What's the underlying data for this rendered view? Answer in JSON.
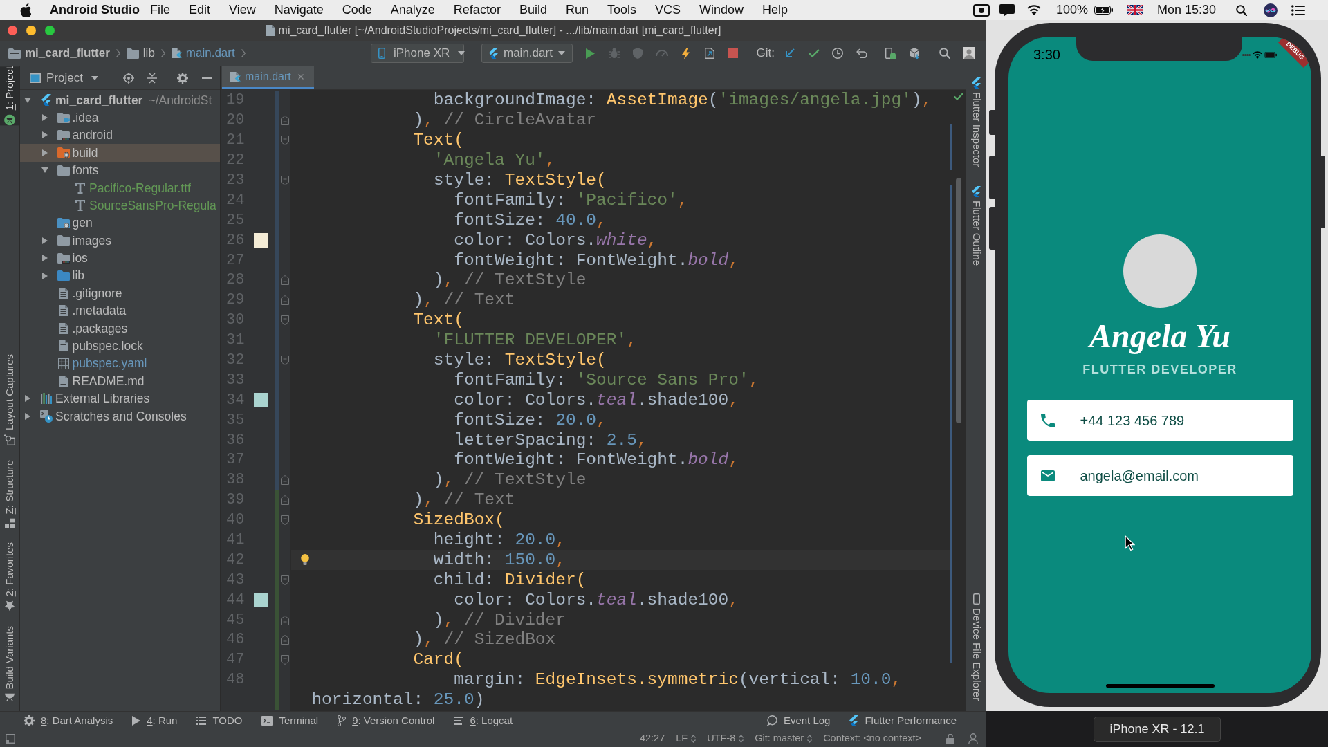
{
  "menu_bar": {
    "app": "Android Studio",
    "menus": [
      "File",
      "Edit",
      "View",
      "Navigate",
      "Code",
      "Analyze",
      "Refactor",
      "Build",
      "Run",
      "Tools",
      "VCS",
      "Window",
      "Help"
    ],
    "battery": "100%",
    "clock": "Mon 15:30"
  },
  "window": {
    "title": "mi_card_flutter [~/AndroidStudioProjects/mi_card_flutter] - .../lib/main.dart [mi_card_flutter]"
  },
  "breadcrumbs": [
    {
      "label": "mi_card_flutter",
      "kind": "project-folder"
    },
    {
      "label": "lib",
      "kind": "folder"
    },
    {
      "label": "main.dart",
      "kind": "dart",
      "color": "#6897bb"
    }
  ],
  "toolbar": {
    "device": "iPhone XR",
    "run_config": "main.dart",
    "vcs_label": "Git:"
  },
  "left_tool_windows": {
    "top": [
      {
        "label": "1: Project",
        "kind": "project",
        "mnemonic": true,
        "selected": true
      }
    ],
    "bottom": [
      {
        "label": "Layout Captures",
        "kind": "layout-captures",
        "mnemonic": false,
        "selected": false
      },
      {
        "label": "Z: Structure",
        "kind": "structure",
        "mnemonic": true,
        "selected": false
      },
      {
        "label": "2: Favorites",
        "kind": "favorites",
        "mnemonic": true,
        "selected": false
      },
      {
        "label": "Build Variants",
        "kind": "build-variants",
        "mnemonic": false,
        "selected": false
      }
    ]
  },
  "project": {
    "title": "Project",
    "tree": [
      {
        "label": "mi_card_flutter",
        "path": "~/AndroidSt",
        "kind": "flutter",
        "expanded": true,
        "selected": false,
        "children": [
          {
            "label": ".idea",
            "kind": "idea-folder",
            "expanded": false,
            "selected": false
          },
          {
            "label": "android",
            "kind": "module-folder",
            "expanded": false,
            "selected": false
          },
          {
            "label": "build",
            "kind": "excluded-folder",
            "expanded": false,
            "selected": true
          },
          {
            "label": "fonts",
            "kind": "folder",
            "expanded": true,
            "selected": false,
            "children": [
              {
                "label": "Pacifico-Regular.ttf",
                "kind": "font",
                "color": "#629755",
                "selected": false
              },
              {
                "label": "SourceSansPro-Regula",
                "kind": "font",
                "color": "#629755",
                "selected": false
              }
            ]
          },
          {
            "label": "gen",
            "kind": "generated-folder",
            "selected": false
          },
          {
            "label": "images",
            "kind": "folder",
            "expanded": false,
            "selected": false
          },
          {
            "label": "ios",
            "kind": "module-folder",
            "expanded": false,
            "selected": false
          },
          {
            "label": "lib",
            "kind": "source-folder",
            "expanded": false,
            "selected": false
          },
          {
            "label": ".gitignore",
            "kind": "file",
            "selected": false
          },
          {
            "label": ".metadata",
            "kind": "file",
            "selected": false
          },
          {
            "label": ".packages",
            "kind": "file",
            "selected": false
          },
          {
            "label": "pubspec.lock",
            "kind": "file",
            "selected": false
          },
          {
            "label": "pubspec.yaml",
            "kind": "table-file",
            "color": "#6897bb",
            "selected": false
          },
          {
            "label": "README.md",
            "kind": "file",
            "selected": false
          }
        ]
      },
      {
        "label": "External Libraries",
        "kind": "libraries",
        "expanded": false,
        "selected": false
      },
      {
        "label": "Scratches and Consoles",
        "kind": "scratches",
        "expanded": false,
        "selected": false
      }
    ]
  },
  "editor": {
    "tabs": [
      {
        "label": "main.dart",
        "color": "#6897bb",
        "selected": true
      }
    ],
    "lines": [
      {
        "number": "19",
        "change": {
          "kind": "modified"
        },
        "current": false,
        "tokens": [
          {
            "kind": "plain",
            "text": "              backgroundImage: "
          },
          {
            "kind": "call",
            "text": "AssetImage"
          },
          {
            "kind": "plain",
            "text": "("
          },
          {
            "kind": "string",
            "text": "'images/angela.jpg'"
          },
          {
            "kind": "plain",
            "text": ")"
          },
          {
            "kind": "comma",
            "text": ","
          }
        ]
      },
      {
        "number": "20",
        "change": {
          "kind": "modified"
        },
        "current": false,
        "fold": {
          "kind": "end"
        },
        "tokens": [
          {
            "kind": "plain",
            "text": "            )"
          },
          {
            "kind": "comma",
            "text": ","
          },
          {
            "kind": "comment",
            "text": " // CircleAvatar"
          }
        ]
      },
      {
        "number": "21",
        "change": {
          "kind": "modified"
        },
        "current": false,
        "fold": {
          "kind": "start"
        },
        "tokens": [
          {
            "kind": "call",
            "text": "            Text("
          }
        ]
      },
      {
        "number": "22",
        "change": {
          "kind": "modified"
        },
        "current": false,
        "tokens": [
          {
            "kind": "string",
            "text": "              'Angela Yu'"
          },
          {
            "kind": "comma",
            "text": ","
          }
        ]
      },
      {
        "number": "23",
        "change": {
          "kind": "modified"
        },
        "current": false,
        "fold": {
          "kind": "start"
        },
        "tokens": [
          {
            "kind": "plain",
            "text": "              style: "
          },
          {
            "kind": "call",
            "text": "TextStyle("
          }
        ]
      },
      {
        "number": "24",
        "change": {
          "kind": "modified"
        },
        "current": false,
        "tokens": [
          {
            "kind": "plain",
            "text": "                fontFamily: "
          },
          {
            "kind": "string",
            "text": "'Pacifico'"
          },
          {
            "kind": "comma",
            "text": ","
          }
        ]
      },
      {
        "number": "25",
        "change": {
          "kind": "modified"
        },
        "current": false,
        "tokens": [
          {
            "kind": "plain",
            "text": "                fontSize: "
          },
          {
            "kind": "number",
            "text": "40.0"
          },
          {
            "kind": "comma",
            "text": ","
          }
        ]
      },
      {
        "number": "26",
        "change": {
          "kind": "modified"
        },
        "current": false,
        "color": "#f4ecd6",
        "tokens": [
          {
            "kind": "plain",
            "text": "                color: Colors."
          },
          {
            "kind": "field",
            "text": "white"
          },
          {
            "kind": "comma",
            "text": ","
          }
        ]
      },
      {
        "number": "27",
        "change": {
          "kind": "modified"
        },
        "current": false,
        "tokens": [
          {
            "kind": "plain",
            "text": "                fontWeight: FontWeight."
          },
          {
            "kind": "field",
            "text": "bold"
          },
          {
            "kind": "comma",
            "text": ","
          }
        ]
      },
      {
        "number": "28",
        "change": {
          "kind": "modified"
        },
        "current": false,
        "fold": {
          "kind": "end"
        },
        "tokens": [
          {
            "kind": "plain",
            "text": "              )"
          },
          {
            "kind": "comma",
            "text": ","
          },
          {
            "kind": "comment",
            "text": " // TextStyle"
          }
        ]
      },
      {
        "number": "29",
        "change": {
          "kind": "modified"
        },
        "current": false,
        "fold": {
          "kind": "end"
        },
        "tokens": [
          {
            "kind": "plain",
            "text": "            )"
          },
          {
            "kind": "comma",
            "text": ","
          },
          {
            "kind": "comment",
            "text": " // Text"
          }
        ]
      },
      {
        "number": "30",
        "change": {
          "kind": "modified"
        },
        "current": false,
        "fold": {
          "kind": "start"
        },
        "tokens": [
          {
            "kind": "call",
            "text": "            Text("
          }
        ]
      },
      {
        "number": "31",
        "change": {
          "kind": "modified"
        },
        "current": false,
        "tokens": [
          {
            "kind": "string",
            "text": "              'FLUTTER DEVELOPER'"
          },
          {
            "kind": "comma",
            "text": ","
          }
        ]
      },
      {
        "number": "32",
        "change": {
          "kind": "modified"
        },
        "current": false,
        "fold": {
          "kind": "start"
        },
        "tokens": [
          {
            "kind": "plain",
            "text": "              style: "
          },
          {
            "kind": "call",
            "text": "TextStyle("
          }
        ]
      },
      {
        "number": "33",
        "change": {
          "kind": "modified"
        },
        "current": false,
        "tokens": [
          {
            "kind": "plain",
            "text": "                fontFamily: "
          },
          {
            "kind": "string",
            "text": "'Source Sans Pro'"
          },
          {
            "kind": "comma",
            "text": ","
          }
        ]
      },
      {
        "number": "34",
        "change": {
          "kind": "modified"
        },
        "current": false,
        "color": "#a9d3cf",
        "tokens": [
          {
            "kind": "plain",
            "text": "                color: Colors."
          },
          {
            "kind": "field",
            "text": "teal"
          },
          {
            "kind": "plain",
            "text": ".shade100"
          },
          {
            "kind": "comma",
            "text": ","
          }
        ]
      },
      {
        "number": "35",
        "change": {
          "kind": "modified"
        },
        "current": false,
        "tokens": [
          {
            "kind": "plain",
            "text": "                fontSize: "
          },
          {
            "kind": "number",
            "text": "20.0"
          },
          {
            "kind": "comma",
            "text": ","
          }
        ]
      },
      {
        "number": "36",
        "change": {
          "kind": "modified"
        },
        "current": false,
        "tokens": [
          {
            "kind": "plain",
            "text": "                letterSpacing: "
          },
          {
            "kind": "number",
            "text": "2.5"
          },
          {
            "kind": "comma",
            "text": ","
          }
        ]
      },
      {
        "number": "37",
        "change": {
          "kind": "modified"
        },
        "current": false,
        "tokens": [
          {
            "kind": "plain",
            "text": "                fontWeight: FontWeight."
          },
          {
            "kind": "field",
            "text": "bold"
          },
          {
            "kind": "comma",
            "text": ","
          }
        ]
      },
      {
        "number": "38",
        "change": {
          "kind": "modified"
        },
        "current": false,
        "fold": {
          "kind": "end"
        },
        "tokens": [
          {
            "kind": "plain",
            "text": "              )"
          },
          {
            "kind": "comma",
            "text": ","
          },
          {
            "kind": "comment",
            "text": " // TextStyle"
          }
        ]
      },
      {
        "number": "39",
        "change": {
          "kind": "added"
        },
        "current": false,
        "fold": {
          "kind": "end"
        },
        "tokens": [
          {
            "kind": "plain",
            "text": "            )"
          },
          {
            "kind": "comma",
            "text": ","
          },
          {
            "kind": "comment",
            "text": " // Text"
          }
        ]
      },
      {
        "number": "40",
        "change": {
          "kind": "added"
        },
        "current": false,
        "fold": {
          "kind": "start"
        },
        "tokens": [
          {
            "kind": "call",
            "text": "            SizedBox("
          }
        ]
      },
      {
        "number": "41",
        "change": {
          "kind": "added"
        },
        "current": false,
        "tokens": [
          {
            "kind": "plain",
            "text": "              height: "
          },
          {
            "kind": "number",
            "text": "20.0"
          },
          {
            "kind": "comma",
            "text": ","
          }
        ]
      },
      {
        "number": "42",
        "change": {
          "kind": "added"
        },
        "current": true,
        "bulb": true,
        "tokens": [
          {
            "kind": "plain",
            "text": "              width: "
          },
          {
            "kind": "number",
            "text": "150.0"
          },
          {
            "kind": "comma",
            "text": ","
          }
        ]
      },
      {
        "number": "43",
        "change": {
          "kind": "added"
        },
        "current": false,
        "fold": {
          "kind": "start"
        },
        "tokens": [
          {
            "kind": "plain",
            "text": "              child: "
          },
          {
            "kind": "call",
            "text": "Divider("
          }
        ]
      },
      {
        "number": "44",
        "change": {
          "kind": "added"
        },
        "current": false,
        "color": "#a9d3cf",
        "tokens": [
          {
            "kind": "plain",
            "text": "                color: Colors."
          },
          {
            "kind": "field",
            "text": "teal"
          },
          {
            "kind": "plain",
            "text": ".shade100"
          },
          {
            "kind": "comma",
            "text": ","
          }
        ]
      },
      {
        "number": "45",
        "change": {
          "kind": "added"
        },
        "current": false,
        "fold": {
          "kind": "end"
        },
        "tokens": [
          {
            "kind": "plain",
            "text": "              )"
          },
          {
            "kind": "comma",
            "text": ","
          },
          {
            "kind": "comment",
            "text": " // Divider"
          }
        ]
      },
      {
        "number": "46",
        "change": {
          "kind": "added"
        },
        "current": false,
        "fold": {
          "kind": "end"
        },
        "tokens": [
          {
            "kind": "plain",
            "text": "            )"
          },
          {
            "kind": "comma",
            "text": ","
          },
          {
            "kind": "comment",
            "text": " // SizedBox"
          }
        ]
      },
      {
        "number": "47",
        "change": {
          "kind": "added"
        },
        "current": false,
        "fold": {
          "kind": "start"
        },
        "tokens": [
          {
            "kind": "call",
            "text": "            Card("
          }
        ]
      },
      {
        "number": "48",
        "change": {
          "kind": "added"
        },
        "current": false,
        "tokens": [
          {
            "kind": "plain",
            "text": "                margin: "
          },
          {
            "kind": "call",
            "text": "EdgeInsets.symmetric"
          },
          {
            "kind": "plain",
            "text": "(vertical: "
          },
          {
            "kind": "number",
            "text": "10.0"
          },
          {
            "kind": "comma",
            "text": ","
          }
        ]
      },
      {
        "change": {
          "kind": "added"
        },
        "current": false,
        "tokens": [
          {
            "kind": "plain",
            "text": "  horizontal: "
          },
          {
            "kind": "number",
            "text": "25.0"
          },
          {
            "kind": "plain",
            "text": ")"
          }
        ]
      }
    ]
  },
  "right_tool_windows": {
    "top": [
      {
        "label": "Flutter Inspector",
        "kind": "flutter"
      },
      {
        "label": "Flutter Outline",
        "kind": "flutter"
      }
    ],
    "bottom": [
      {
        "label": "Device File Explorer",
        "kind": "device"
      }
    ]
  },
  "bottom_tool_windows": {
    "left": [
      {
        "label": "8: Dart Analysis",
        "kind": "dart-analysis",
        "mnemonic": true
      },
      {
        "label": "4: Run",
        "kind": "run",
        "mnemonic": true
      },
      {
        "label": "TODO",
        "kind": "todo",
        "mnemonic": false
      },
      {
        "label": "Terminal",
        "kind": "terminal",
        "mnemonic": false
      },
      {
        "label": "9: Version Control",
        "kind": "version-control",
        "mnemonic": true
      },
      {
        "label": "6: Logcat",
        "kind": "logcat",
        "mnemonic": true
      }
    ],
    "right": [
      {
        "label": "Event Log",
        "kind": "event-log",
        "mnemonic": false
      },
      {
        "label": "Flutter Performance",
        "kind": "flutter",
        "mnemonic": false
      }
    ]
  },
  "status_bar": {
    "items": [
      {
        "text": "42:27",
        "dropdown": false
      },
      {
        "text": "LF",
        "dropdown": true
      },
      {
        "text": "UTF-8",
        "dropdown": true
      },
      {
        "text": "Git: master",
        "dropdown": true
      },
      {
        "text": "Context: <no context>",
        "dropdown": false
      }
    ]
  },
  "simulator": {
    "time": "3:30",
    "debug_banner": "DEBUG",
    "name": "Angela Yu",
    "job_title": "FLUTTER DEVELOPER",
    "cards": [
      {
        "kind": "phone",
        "text": "+44 123 456 789"
      },
      {
        "kind": "email",
        "text": "angela@email.com"
      }
    ],
    "device_label": "iPhone XR - 12.1"
  }
}
